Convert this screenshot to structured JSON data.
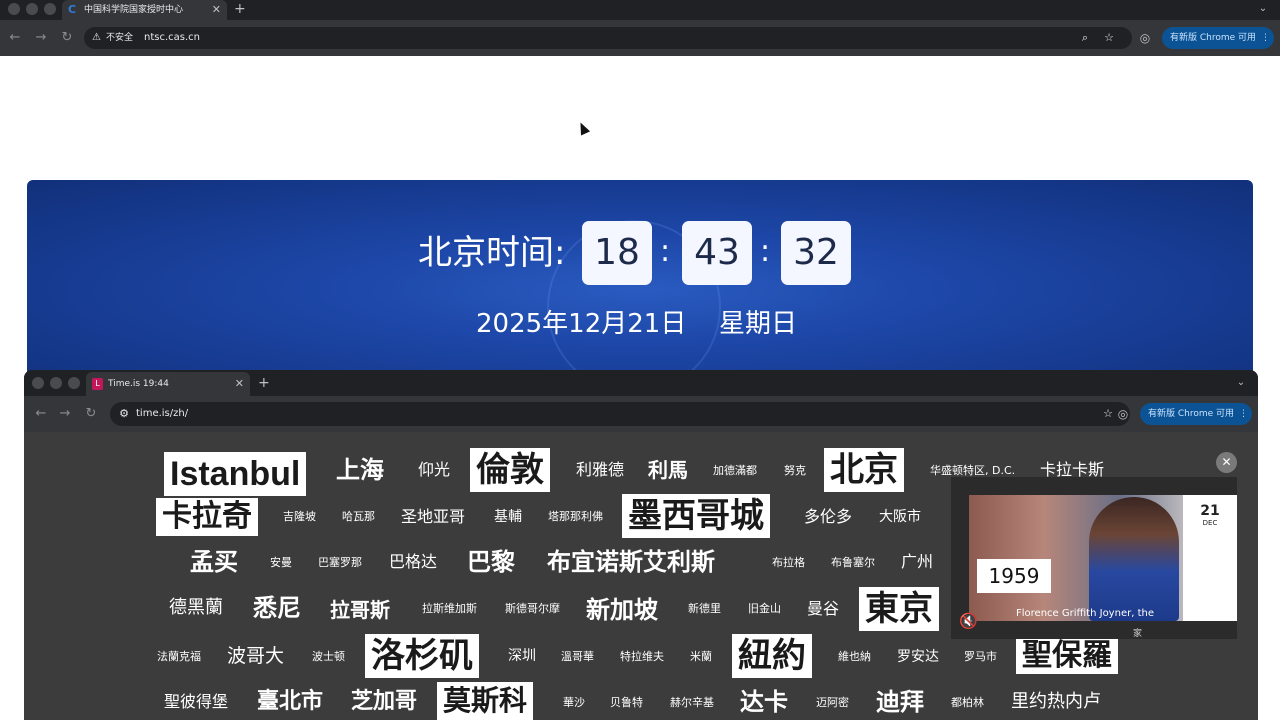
{
  "outer_browser": {
    "tab_title": "中国科学院国家授时中心",
    "new_tab": "+",
    "security_label": "不安全",
    "url": "ntsc.cas.cn",
    "update_label": "有新版 Chrome 可用"
  },
  "clock": {
    "label": "北京时间:",
    "hours": "18",
    "minutes": "43",
    "seconds": "32",
    "sep1": ":",
    "sep2": ":",
    "date": "2025年12月21日",
    "weekday": "星期日"
  },
  "inner_browser": {
    "tab_title": "Time.is 19:44",
    "new_tab": "+",
    "url": "time.is/zh/",
    "update_label": "有新版 Chrome 可用"
  },
  "cities": {
    "row1": [
      "Istanbul",
      "上海",
      "仰光",
      "倫敦",
      "利雅德",
      "利馬",
      "加德滿都",
      "努克",
      "北京",
      "华盛顿特区, D.C.",
      "卡拉卡斯"
    ],
    "row2": [
      "卡拉奇",
      "吉隆坡",
      "哈瓦那",
      "圣地亚哥",
      "基輔",
      "塔那那利佛",
      "墨西哥城",
      "多伦多",
      "大阪市"
    ],
    "row3": [
      "孟买",
      "安曼",
      "巴塞罗那",
      "巴格达",
      "巴黎",
      "布宜诺斯艾利斯",
      "布拉格",
      "布鲁塞尔",
      "广州"
    ],
    "row4": [
      "德黑蘭",
      "悉尼",
      "拉哥斯",
      "拉斯维加斯",
      "斯德哥尔摩",
      "新加坡",
      "新德里",
      "旧金山",
      "曼谷",
      "東京"
    ],
    "row5": [
      "法蘭克福",
      "波哥大",
      "波士顿",
      "洛杉矶",
      "深圳",
      "溫哥華",
      "特拉维夫",
      "米蘭",
      "紐約",
      "維也納",
      "罗安达",
      "罗马市",
      "聖保羅"
    ],
    "row6": [
      "聖彼得堡",
      "臺北市",
      "芝加哥",
      "莫斯科",
      "華沙",
      "贝鲁特",
      "赫尔辛基",
      "达卡",
      "迈阿密",
      "迪拜",
      "都柏林",
      "里约热内卢"
    ]
  },
  "video": {
    "year": "1959",
    "day": "21",
    "month": "DEC",
    "caption": "Florence Griffith Joyner, the",
    "brand": "家"
  },
  "icons": {
    "back": "back-arrow-icon",
    "forward": "forward-arrow-icon",
    "reload": "reload-icon",
    "warning": "warning-icon",
    "zoom": "zoom-icon",
    "star": "bookmark-star-icon",
    "account": "account-icon",
    "mute": "mute-icon",
    "close": "close-icon"
  },
  "colors": {
    "banner_blue": "#1d47a8",
    "update_pill": "#0b5394",
    "digit_box": "#f4f7ff",
    "chrome_dark": "#35363a"
  }
}
